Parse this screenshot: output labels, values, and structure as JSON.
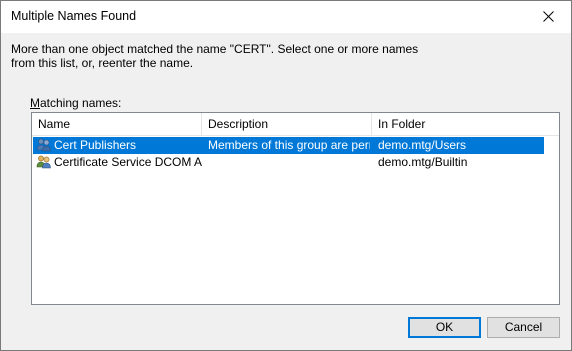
{
  "window": {
    "title": "Multiple Names Found"
  },
  "message": {
    "line1": "More than one object matched the name \"CERT\". Select one or more names",
    "line2": "from this list, or, reenter the name."
  },
  "matching_label": {
    "underlined_char": "M",
    "rest": "atching names:"
  },
  "list": {
    "columns": [
      "Name",
      "Description",
      "In Folder"
    ],
    "rows": [
      {
        "name": "Cert Publishers",
        "description": "Members of this group are perm...",
        "folder": "demo.mtg/Users",
        "icon": "group-icon",
        "selected": true
      },
      {
        "name": "Certificate Service DCOM Ac...",
        "description": "",
        "folder": "demo.mtg/Builtin",
        "icon": "builtin-group-icon",
        "selected": false
      }
    ]
  },
  "buttons": {
    "ok": "OK",
    "cancel": "Cancel"
  },
  "colors": {
    "selection": "#0078d7",
    "default_button_border": "#0078d7"
  }
}
